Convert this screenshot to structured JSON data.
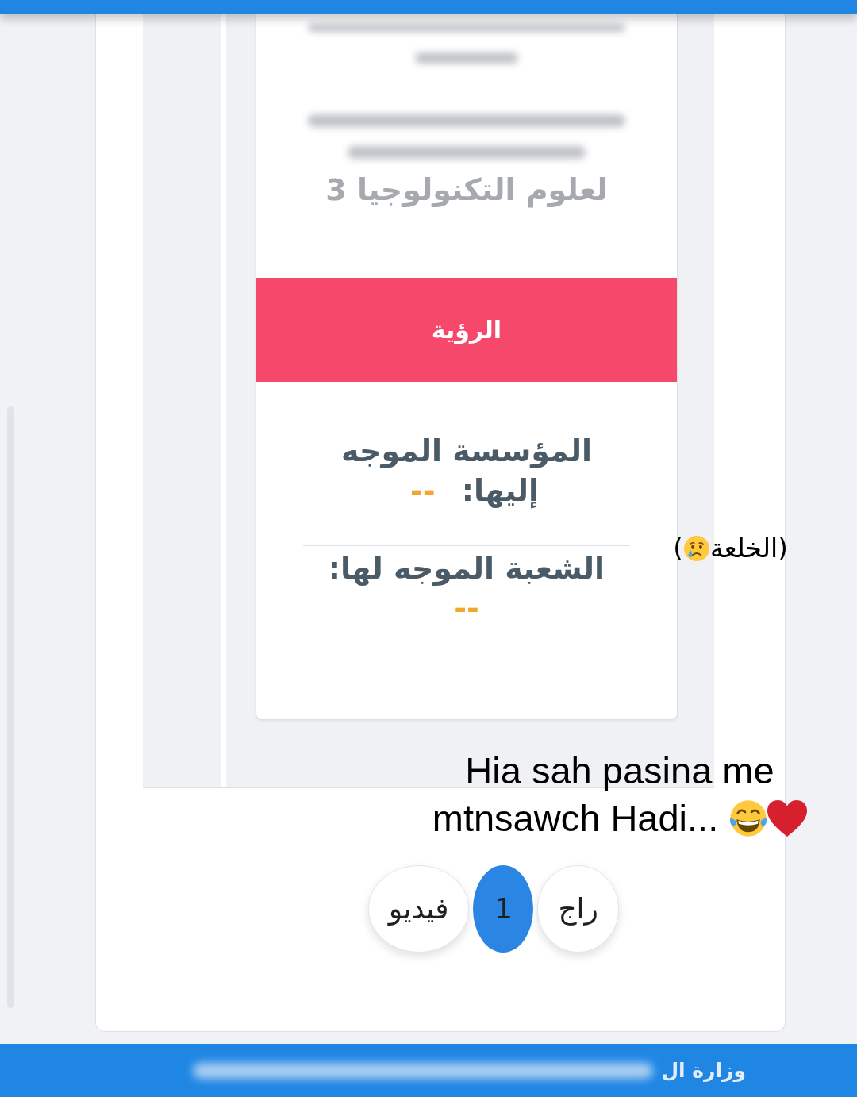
{
  "card": {
    "subtitle": "لعلوم التكنولوجيا 3",
    "banner": "الرؤية",
    "fields": [
      {
        "label": "المؤسسة الموجه إليها:",
        "value": "--"
      },
      {
        "label": "الشعبة الموجه لها:",
        "value": "--"
      }
    ]
  },
  "pagination": [
    {
      "label": "راج",
      "selected": false
    },
    {
      "label": "1",
      "selected": true
    },
    {
      "label": "فيديو",
      "selected": false
    }
  ],
  "footer": {
    "text": "وزارة ال"
  },
  "side_caption": {
    "text": "(الخلعة",
    "closing": ")"
  },
  "bottom_caption": {
    "lines": [
      "Hia sah pasina me",
      "mtnsawch Hadi..."
    ]
  }
}
